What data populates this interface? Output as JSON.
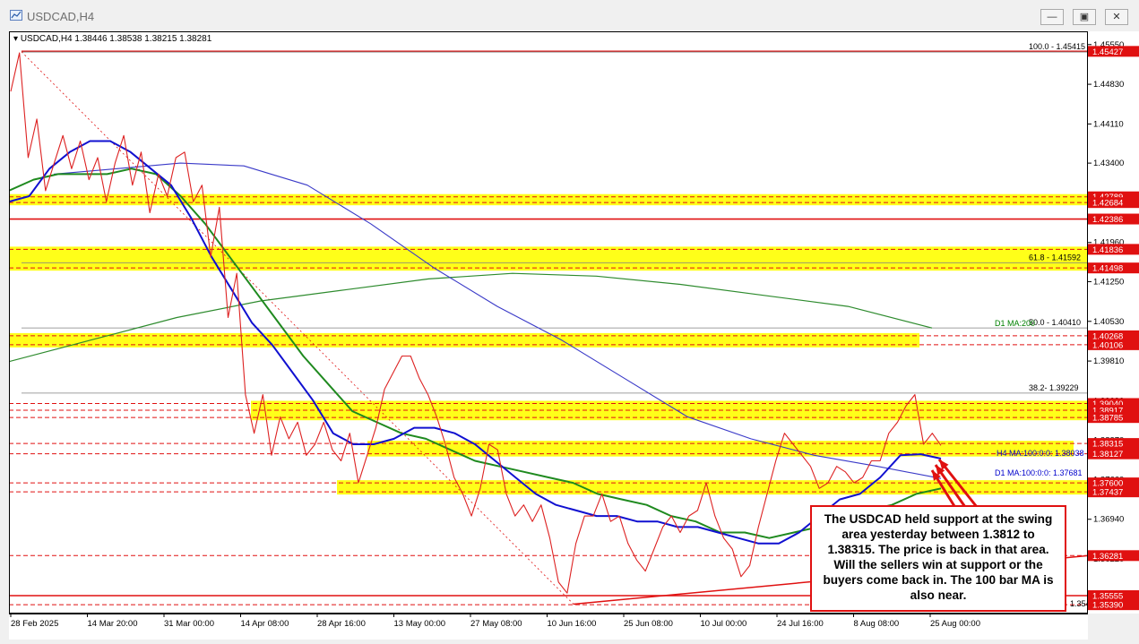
{
  "window": {
    "title": "USDCAD,H4",
    "buttons": [
      "minimize",
      "restore",
      "close"
    ]
  },
  "symbol_info": "USDCAD,H4  1.38446 1.38538 1.38215 1.38281",
  "annotation": "The USDCAD held support at the swing area yesterday between 1.3812 to 1.38315. The price is back in that area.  Will the sellers win at support or the buyers come back in. The 100 bar MA is also near.",
  "chart_data": {
    "type": "line",
    "title": "USDCAD,H4",
    "y_axis": {
      "range": [
        1.3523,
        1.4579
      ],
      "ticks": [
        1.4555,
        1.4483,
        1.4411,
        1.434,
        1.4268,
        1.4196,
        1.4125,
        1.4053,
        1.3981,
        1.3909,
        1.3837,
        1.3766,
        1.3694,
        1.3622,
        1.355
      ]
    },
    "x_axis": {
      "labels": [
        "28 Feb 2025",
        "14 Mar 20:00",
        "31 Mar 00:00",
        "14 Apr 08:00",
        "28 Apr 16:00",
        "13 May 00:00",
        "27 May 08:00",
        "10 Jun 16:00",
        "25 Jun 08:00",
        "10 Jul 00:00",
        "24 Jul 16:00",
        "8 Aug 08:00",
        "25 Aug 00:00"
      ]
    },
    "price_labels": [
      {
        "text": "1.45427",
        "value": 1.45427,
        "color": "#e01010"
      },
      {
        "text": "1.42789",
        "value": 1.42789,
        "color": "#e01010"
      },
      {
        "text": "1.42684",
        "value": 1.42684,
        "color": "#e01010"
      },
      {
        "text": "1.42386",
        "value": 1.42386,
        "color": "#e01010"
      },
      {
        "text": "1.41836",
        "value": 1.41836,
        "color": "#e01010"
      },
      {
        "text": "1.41498",
        "value": 1.41498,
        "color": "#e01010"
      },
      {
        "text": "1.40268",
        "value": 1.40268,
        "color": "#e01010"
      },
      {
        "text": "1.40106",
        "value": 1.40106,
        "color": "#e01010"
      },
      {
        "text": "1.39040",
        "value": 1.3904,
        "color": "#e01010"
      },
      {
        "text": "1.38917",
        "value": 1.38917,
        "color": "#e01010"
      },
      {
        "text": "1.38785",
        "value": 1.38785,
        "color": "#e01010"
      },
      {
        "text": "1.38315",
        "value": 1.38315,
        "color": "#e01010"
      },
      {
        "text": "1.38127",
        "value": 1.38127,
        "color": "#e01010"
      },
      {
        "text": "1.37600",
        "value": 1.376,
        "color": "#e01010"
      },
      {
        "text": "1.37437",
        "value": 1.37437,
        "color": "#e01010"
      },
      {
        "text": "1.36281",
        "value": 1.36281,
        "color": "#e01010"
      },
      {
        "text": "1.35555",
        "value": 1.35555,
        "color": "#e01010"
      },
      {
        "text": "1.35390",
        "value": 1.3539,
        "color": "#e01010"
      }
    ],
    "fib_levels": [
      {
        "text": "100.0 - 1.45415",
        "value": 1.45415
      },
      {
        "text": "61.8 - 1.41592",
        "value": 1.41592
      },
      {
        "text": "50.0 - 1.40410",
        "value": 1.4041
      },
      {
        "text": "38.2- 1.39229",
        "value": 1.39229
      }
    ],
    "ma_labels": [
      {
        "text": "D1 MA:200",
        "value": 1.4041,
        "color": "#008000"
      },
      {
        "text": "H4 MA:100:0:0: 1.38038",
        "value": 1.38038,
        "color": "#0000cc"
      },
      {
        "text": "D1 MA:100:0:0: 1.37681",
        "value": 1.37681,
        "color": "#0000cc"
      }
    ],
    "hidden_label": "1.35406",
    "support_zones": [
      {
        "from": 1.42684,
        "to": 1.42789
      },
      {
        "from": 1.41498,
        "to": 1.41836
      },
      {
        "from": 1.40106,
        "to": 1.40268
      },
      {
        "from": 1.38785,
        "to": 1.3904
      },
      {
        "from": 1.38127,
        "to": 1.38315
      },
      {
        "from": 1.37437,
        "to": 1.376
      }
    ],
    "price_series": [
      1.447,
      1.454,
      1.435,
      1.442,
      1.429,
      1.434,
      1.439,
      1.433,
      1.438,
      1.431,
      1.435,
      1.427,
      1.434,
      1.439,
      1.43,
      1.436,
      1.425,
      1.432,
      1.428,
      1.435,
      1.436,
      1.427,
      1.43,
      1.417,
      1.426,
      1.406,
      1.414,
      1.392,
      1.385,
      1.392,
      1.381,
      1.388,
      1.384,
      1.387,
      1.381,
      1.383,
      1.387,
      1.382,
      1.38,
      1.385,
      1.376,
      1.381,
      1.386,
      1.393,
      1.396,
      1.399,
      1.399,
      1.395,
      1.392,
      1.388,
      1.383,
      1.377,
      1.374,
      1.37,
      1.375,
      1.383,
      1.382,
      1.374,
      1.37,
      1.372,
      1.369,
      1.372,
      1.366,
      1.358,
      1.356,
      1.365,
      1.37,
      1.37,
      1.374,
      1.369,
      1.37,
      1.365,
      1.362,
      1.36,
      1.364,
      1.368,
      1.37,
      1.367,
      1.37,
      1.371,
      1.376,
      1.37,
      1.366,
      1.364,
      1.359,
      1.361,
      1.368,
      1.374,
      1.38,
      1.385,
      1.383,
      1.381,
      1.379,
      1.375,
      1.376,
      1.379,
      1.378,
      1.376,
      1.377,
      1.38,
      1.38,
      1.385,
      1.387,
      1.39,
      1.392,
      1.383,
      1.385,
      1.3828
    ],
    "h4_ma100": [
      1.427,
      1.428,
      1.433,
      1.436,
      1.438,
      1.438,
      1.436,
      1.433,
      1.43,
      1.424,
      1.417,
      1.411,
      1.405,
      1.401,
      1.396,
      1.391,
      1.385,
      1.383,
      1.383,
      1.384,
      1.386,
      1.386,
      1.385,
      1.383,
      1.38,
      1.377,
      1.374,
      1.372,
      1.371,
      1.37,
      1.37,
      1.369,
      1.369,
      1.368,
      1.368,
      1.367,
      1.366,
      1.365,
      1.365,
      1.367,
      1.37,
      1.373,
      1.374,
      1.377,
      1.381,
      1.3812,
      1.3804
    ],
    "h4_ma200": [
      1.429,
      1.431,
      1.432,
      1.432,
      1.432,
      1.433,
      1.432,
      1.428,
      1.423,
      1.417,
      1.411,
      1.405,
      1.399,
      1.394,
      1.389,
      1.387,
      1.385,
      1.384,
      1.382,
      1.38,
      1.379,
      1.378,
      1.377,
      1.376,
      1.374,
      1.373,
      1.372,
      1.37,
      1.369,
      1.367,
      1.367,
      1.366,
      1.367,
      1.368,
      1.37,
      1.371,
      1.372,
      1.374,
      1.375
    ],
    "d1_ma100": [
      1.432,
      1.433,
      1.434,
      1.4335,
      1.43,
      1.423,
      1.415,
      1.408,
      1.402,
      1.395,
      1.388,
      1.384,
      1.381,
      1.379,
      1.3768
    ],
    "d1_ma200": [
      1.398,
      1.402,
      1.406,
      1.409,
      1.411,
      1.413,
      1.414,
      1.4135,
      1.412,
      1.41,
      1.408,
      1.4041
    ]
  }
}
